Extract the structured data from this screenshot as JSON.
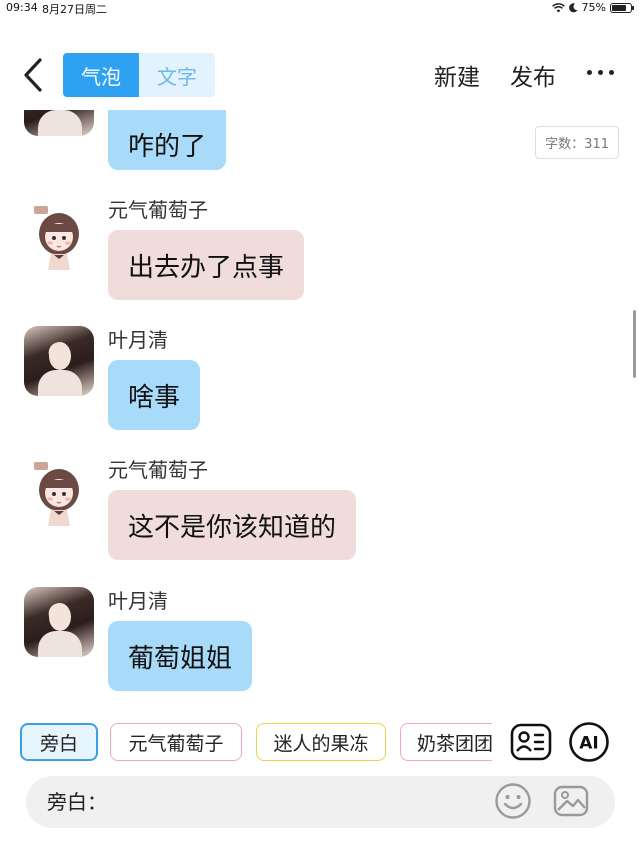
{
  "status_bar": {
    "time": "09:34",
    "date": "8月27日周二",
    "battery": "75%",
    "battery_level": 0.75
  },
  "header": {
    "back_icon": "chevron-left-icon",
    "mode_tabs": [
      {
        "label": "气泡",
        "active": true
      },
      {
        "label": "文字",
        "active": false
      }
    ],
    "new_label": "新建",
    "publish_label": "发布",
    "more_icon": "more-horizontal-icon",
    "accent_color": "#2ea2f0"
  },
  "chat": {
    "word_count": "字数：311",
    "messages": [
      {
        "sender": "",
        "text": "咋的了",
        "style": "blue",
        "avatar": "photo"
      },
      {
        "sender": "元气葡萄子",
        "text": "出去办了点事",
        "style": "pink",
        "avatar": "cartoon"
      },
      {
        "sender": "叶月清",
        "text": "啥事",
        "style": "blue",
        "avatar": "photo"
      },
      {
        "sender": "元气葡萄子",
        "text": "这不是你该知道的",
        "style": "pink",
        "avatar": "cartoon"
      },
      {
        "sender": "叶月清",
        "text": "葡萄姐姐",
        "style": "blue",
        "avatar": "photo"
      }
    ],
    "colors": {
      "blue_bubble": "#a8dbfa",
      "pink_bubble": "#f1dcdc"
    }
  },
  "roles": {
    "chips": [
      "旁白",
      "元气葡萄子",
      "迷人的果冻",
      "奶茶团团"
    ],
    "selected": "旁白",
    "contact_card_icon": "contact-card-icon",
    "ai_label": "AI"
  },
  "input": {
    "label": "旁白：",
    "placeholder": "",
    "emoji_icon": "emoji-smile-icon",
    "image_icon": "image-icon"
  }
}
